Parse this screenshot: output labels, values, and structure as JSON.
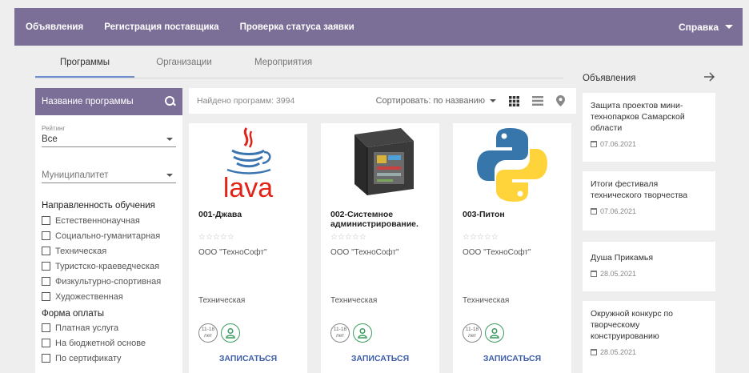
{
  "nav": {
    "items": [
      "Объявления",
      "Регистрация поставщика",
      "Проверка статуса заявки"
    ],
    "help": "Справка"
  },
  "tabs": [
    "Программы",
    "Организации",
    "Мероприятия"
  ],
  "filter": {
    "search_placeholder": "Название программы",
    "rating_label": "Рейтинг",
    "rating_value": "Все",
    "municipality_placeholder": "Муниципалитет",
    "direction_title": "Направленность обучения",
    "directions": [
      "Естественнонаучная",
      "Социально-гуманитарная",
      "Техническая",
      "Туристско-краеведческая",
      "Физкультурно-спортивная",
      "Художественная"
    ],
    "payment_title": "Форма оплаты",
    "payments": [
      "Платная услуга",
      "На бюджетной основе",
      "По сертификату"
    ]
  },
  "sortbar": {
    "found": "Найдено программ: 3994",
    "sort": "Сортировать: по названию"
  },
  "cards": [
    {
      "title": "001-Джава",
      "stars": "☆☆☆☆☆",
      "org": "ООО \"ТехноСофт\"",
      "category": "Техническая",
      "age": "11-18",
      "age_unit": "лет",
      "enroll": "ЗАПИСАТЬСЯ",
      "logo_text": "lava"
    },
    {
      "title": "002-Системное администрирование.",
      "stars": "☆☆☆☆☆",
      "org": "ООО \"ТехноСофт\"",
      "category": "Техническая",
      "age": "11-18",
      "age_unit": "лет",
      "enroll": "ЗАПИСАТЬСЯ"
    },
    {
      "title": "003-Питон",
      "stars": "☆☆☆☆☆",
      "org": "ООО \"ТехноСофт\"",
      "category": "Техническая",
      "age": "11-18",
      "age_unit": "лет",
      "enroll": "ЗАПИСАТЬСЯ"
    }
  ],
  "announcements": {
    "title": "Объявления",
    "items": [
      {
        "text": "Защита проектов мини-технопарков Самарской области",
        "date": "07.06.2021"
      },
      {
        "text": "Итоги фестиваля технического творчества",
        "date": "07.06.2021"
      },
      {
        "text": "Душа Прикамья",
        "date": "28.05.2021"
      },
      {
        "text": "Окружной конкурс по творческому конструированию",
        "date": "28.05.2021"
      }
    ]
  },
  "colors": {
    "header": "#7b6f98",
    "accent": "#6c8ecf",
    "link": "#3f5ea8",
    "java_red": "#e2231a",
    "green": "#3a9c5e"
  }
}
